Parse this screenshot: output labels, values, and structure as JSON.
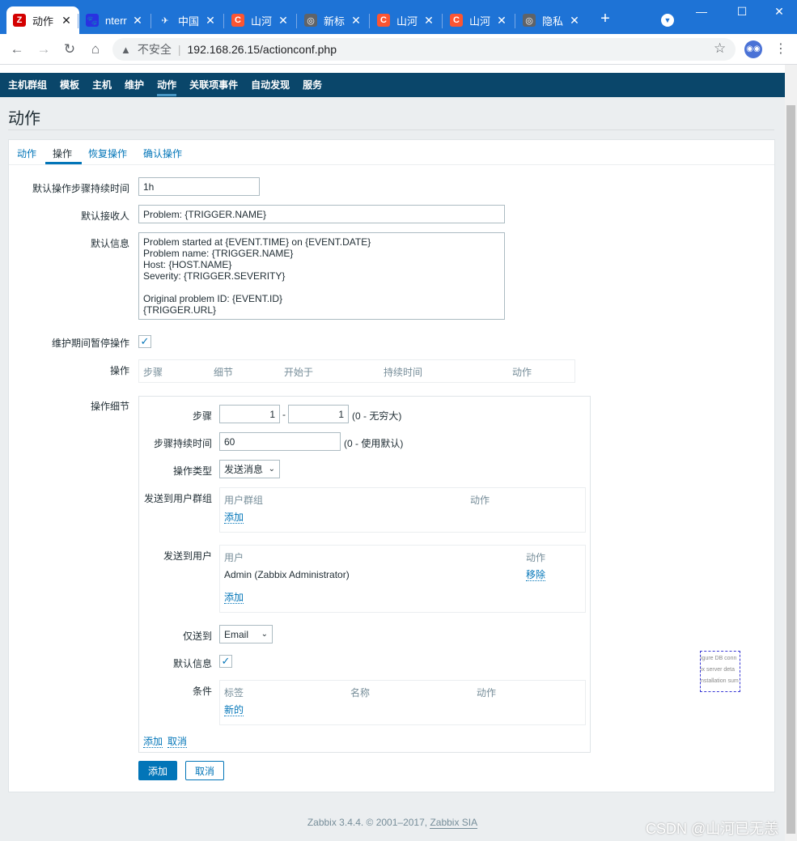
{
  "browser": {
    "tabs": [
      {
        "icon": "zabbix-icon",
        "icon_letter": "Z",
        "icon_color": "#d40000",
        "title": "动作"
      },
      {
        "icon": "baidu-paw-icon",
        "icon_letter": "🐾",
        "icon_color": "#2932e1",
        "title": "nterr"
      },
      {
        "icon": "china-site-icon",
        "icon_letter": "✈",
        "icon_color": "#1e73d6",
        "title": "中国"
      },
      {
        "icon": "csdn-icon",
        "icon_letter": "C",
        "icon_color": "#fc5531",
        "title": "山河"
      },
      {
        "icon": "globe-icon",
        "icon_letter": "◎",
        "icon_color": "#5f6368",
        "title": "新标"
      },
      {
        "icon": "csdn-icon",
        "icon_letter": "C",
        "icon_color": "#fc5531",
        "title": "山河"
      },
      {
        "icon": "csdn-icon",
        "icon_letter": "C",
        "icon_color": "#fc5531",
        "title": "山河"
      },
      {
        "icon": "globe-icon",
        "icon_letter": "◎",
        "icon_color": "#5f6368",
        "title": "隐私"
      }
    ],
    "new_tab_label": "+",
    "insecure_label": "不安全",
    "url": "192.168.26.15/actionconf.php"
  },
  "topnav": {
    "items": [
      "主机群组",
      "模板",
      "主机",
      "维护",
      "动作",
      "关联项事件",
      "自动发现",
      "服务"
    ],
    "selected": "动作"
  },
  "page_title": "动作",
  "tabs": [
    "动作",
    "操作",
    "恢复操作",
    "确认操作"
  ],
  "form": {
    "default_step_duration_label": "默认操作步骤持续时间",
    "default_step_duration_value": "1h",
    "default_subject_label": "默认接收人",
    "default_subject_value": "Problem: {TRIGGER.NAME}",
    "default_message_label": "默认信息",
    "default_message_value": "Problem started at {EVENT.TIME} on {EVENT.DATE}\nProblem name: {TRIGGER.NAME}\nHost: {HOST.NAME}\nSeverity: {TRIGGER.SEVERITY}\n\nOriginal problem ID: {EVENT.ID}\n{TRIGGER.URL}",
    "pause_in_maintenance_label": "维护期间暂停操作",
    "pause_in_maintenance_checked": true,
    "operations_label": "操作",
    "operations_columns": [
      "步骤",
      "细节",
      "开始于",
      "持续时间",
      "动作"
    ],
    "operation_details_label": "操作细节"
  },
  "details": {
    "steps_label": "步骤",
    "step_from": "1",
    "step_to": "1",
    "step_dash": "-",
    "steps_hint": "(0 - 无穷大)",
    "step_duration_label": "步骤持续时间",
    "step_duration_value": "60",
    "step_duration_hint": "(0 - 使用默认)",
    "operation_type_label": "操作类型",
    "operation_type_value": "发送消息",
    "send_to_groups_label": "发送到用户群组",
    "groups_columns": [
      "用户群组",
      "动作"
    ],
    "groups_add": "添加",
    "send_to_users_label": "发送到用户",
    "users_columns": [
      "用户",
      "动作"
    ],
    "users_rows": [
      {
        "name": "Admin (Zabbix Administrator)",
        "action": "移除"
      }
    ],
    "users_add": "添加",
    "send_only_to_label": "仅送到",
    "send_only_to_value": "Email",
    "default_message_label": "默认信息",
    "default_message_checked": true,
    "conditions_label": "条件",
    "conditions_columns": [
      "标签",
      "名称",
      "动作"
    ],
    "conditions_new": "新的",
    "add_link": "添加",
    "cancel_link": "取消"
  },
  "buttons": {
    "add": "添加",
    "cancel": "取消"
  },
  "footer": {
    "text": "Zabbix 3.4.4. © 2001–2017, ",
    "link": "Zabbix SIA"
  },
  "overlay_snippet": [
    "igure DB conn",
    "ix server deta",
    "nstallation sum"
  ],
  "watermark": "CSDN @山河已无恙"
}
